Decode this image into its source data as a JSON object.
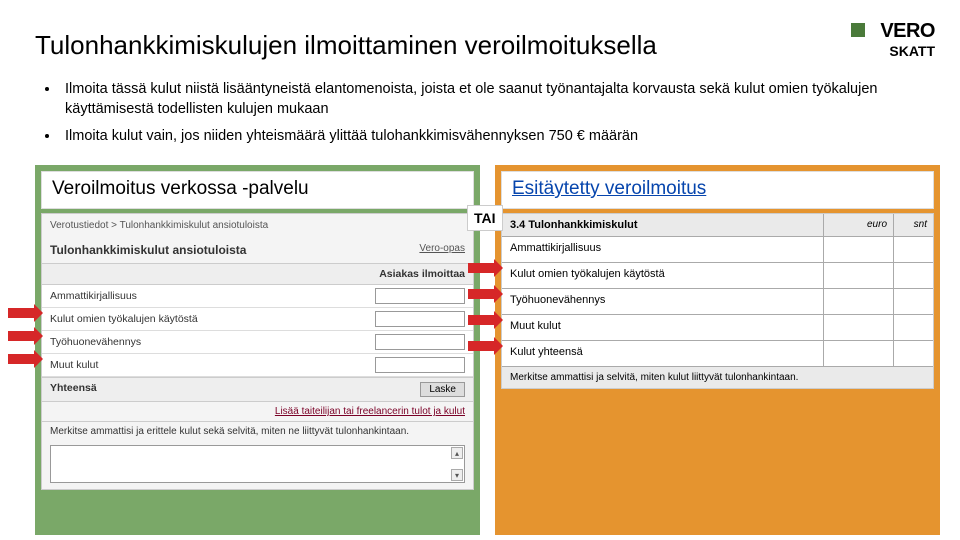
{
  "logo": {
    "line1": "VERO",
    "line2": "SKATT"
  },
  "title": "Tulonhankkimiskulujen ilmoittaminen veroilmoituksella",
  "bullets": [
    "Ilmoita tässä kulut niistä lisääntyneistä elantomenoista, joista et ole saanut työnantajalta korvausta sekä kulut omien työkalujen käyttämisestä todellisten kulujen mukaan",
    "Ilmoita kulut vain, jos niiden yhteismäärä ylittää tulohankkimisvähennyksen 750 € määrän"
  ],
  "left": {
    "title": "Veroilmoitus verkossa -palvelu",
    "breadcrumb": "Verotustiedot > Tulonhankkimiskulut ansiotuloista",
    "heading": "Tulonhankkimiskulut ansiotuloista",
    "guide": "Vero-opas",
    "subheader": "Asiakas ilmoittaa",
    "rows": [
      "Ammattikirjallisuus",
      "Kulut omien työkalujen käytöstä",
      "Työhuonevähennys",
      "Muut kulut"
    ],
    "total": "Yhteensä",
    "calc": "Laske",
    "link": "Lisää taiteilijan tai freelancerin tulot ja kulut",
    "note": "Merkitse ammattisi ja erittele kulut sekä selvitä, miten ne liittyvät tulonhankintaan."
  },
  "tai": "TAI",
  "right": {
    "title": "Esitäytetty veroilmoitus",
    "section": "3.4 Tulonhankkimiskulut",
    "col_euro": "euro",
    "col_snt": "snt",
    "rows": [
      "Ammattikirjallisuus",
      "Kulut omien työkalujen käytöstä",
      "Työhuonevähennys",
      "Muut kulut",
      "Kulut yhteensä"
    ],
    "note": "Merkitse ammattisi ja selvitä, miten kulut liittyvät tulonhankintaan."
  }
}
